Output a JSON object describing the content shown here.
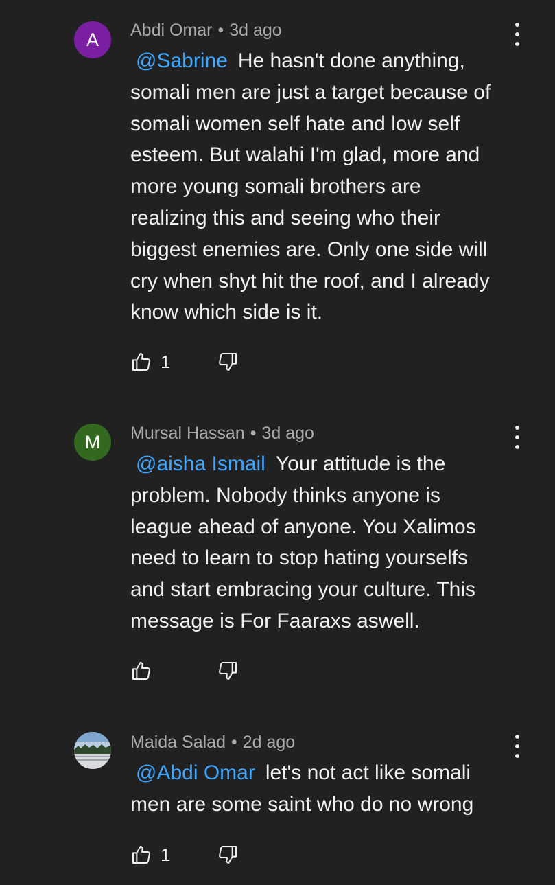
{
  "comments": [
    {
      "avatar_letter": "A",
      "avatar_color": "#7b1fa2",
      "author": "Abdi Omar",
      "separator": "•",
      "time": "3d ago",
      "mention": "@Sabrine",
      "text_lines": [
        "He hasn't done anything,",
        "somali men are just a target because of",
        "somali women self hate and low self",
        "esteem. But walahi I'm glad, more and",
        "more young somali brothers are",
        "realizing this and seeing who their",
        "biggest enemies are. Only one side will",
        "cry when shyt hit the roof, and I already",
        "know which side is it."
      ],
      "likes": "1"
    },
    {
      "avatar_letter": "M",
      "avatar_color": "#33691e",
      "author": "Mursal Hassan",
      "separator": "•",
      "time": "3d ago",
      "mention": "@aisha Ismail",
      "text_lines": [
        "Your attitude is the",
        "problem. Nobody thinks anyone is",
        "league ahead of anyone. You Xalimos",
        "need to learn to stop hating yourselfs",
        "and start embracing your culture. This",
        "message is For Faaraxs aswell."
      ],
      "likes": ""
    },
    {
      "avatar_letter": "",
      "avatar_color": "#c9ccd1",
      "author": "Maida Salad",
      "separator": "•",
      "time": "2d ago",
      "mention": "@Abdi Omar",
      "text_lines": [
        "let's not act like somali",
        "men are some saint who do no wrong"
      ],
      "likes": "1"
    }
  ],
  "icons": {
    "like": "thumbs-up-icon",
    "dislike": "thumbs-down-icon",
    "menu": "more-vert-icon"
  }
}
